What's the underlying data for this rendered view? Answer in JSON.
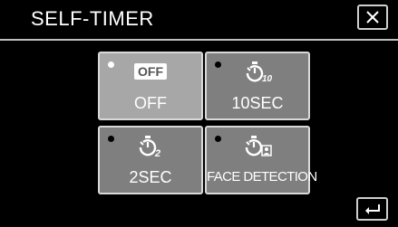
{
  "header": {
    "title": "SELF-TIMER"
  },
  "options": [
    {
      "id": "off",
      "icon": "timer-off-icon",
      "icon_text": "OFF",
      "label": "OFF",
      "selected": true
    },
    {
      "id": "10sec",
      "icon": "timer-10-icon",
      "icon_text": "10",
      "label": "10SEC",
      "selected": false
    },
    {
      "id": "2sec",
      "icon": "timer-2-icon",
      "icon_text": "2",
      "label": "2SEC",
      "selected": false
    },
    {
      "id": "face",
      "icon": "timer-face-icon",
      "label": "FACE DETECTION",
      "selected": false
    }
  ],
  "colors": {
    "tile": "#7f7f7f",
    "tile_selected": "#a7a7a7",
    "background": "#000000"
  }
}
